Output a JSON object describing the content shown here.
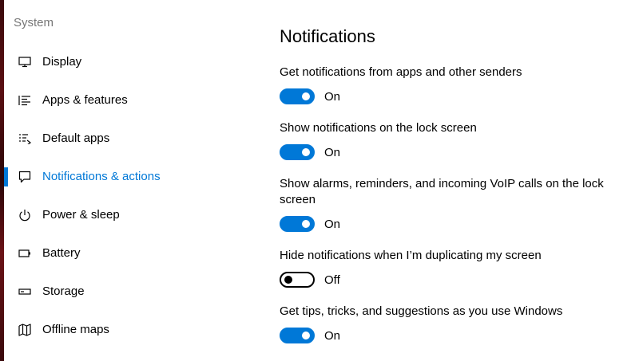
{
  "sidebar": {
    "header": "System",
    "items": [
      {
        "label": "Display",
        "icon": "monitor-icon",
        "active": false
      },
      {
        "label": "Apps & features",
        "icon": "list-icon",
        "active": false
      },
      {
        "label": "Default apps",
        "icon": "default-apps-icon",
        "active": false
      },
      {
        "label": "Notifications & actions",
        "icon": "speech-bubble-icon",
        "active": true
      },
      {
        "label": "Power & sleep",
        "icon": "power-icon",
        "active": false
      },
      {
        "label": "Battery",
        "icon": "battery-icon",
        "active": false
      },
      {
        "label": "Storage",
        "icon": "storage-icon",
        "active": false
      },
      {
        "label": "Offline maps",
        "icon": "map-icon",
        "active": false
      }
    ]
  },
  "main": {
    "title": "Notifications",
    "settings": [
      {
        "label": "Get notifications from apps and other senders",
        "state": "On",
        "on": true
      },
      {
        "label": "Show notifications on the lock screen",
        "state": "On",
        "on": true
      },
      {
        "label": "Show alarms, reminders, and incoming VoIP calls on the lock screen",
        "state": "On",
        "on": true
      },
      {
        "label": "Hide notifications when I’m duplicating my screen",
        "state": "Off",
        "on": false
      },
      {
        "label": "Get tips, tricks, and suggestions as you use Windows",
        "state": "On",
        "on": true
      }
    ]
  },
  "colors": {
    "accent": "#0078d7",
    "header_gray": "#767676",
    "text": "#000000",
    "background": "#ffffff"
  }
}
